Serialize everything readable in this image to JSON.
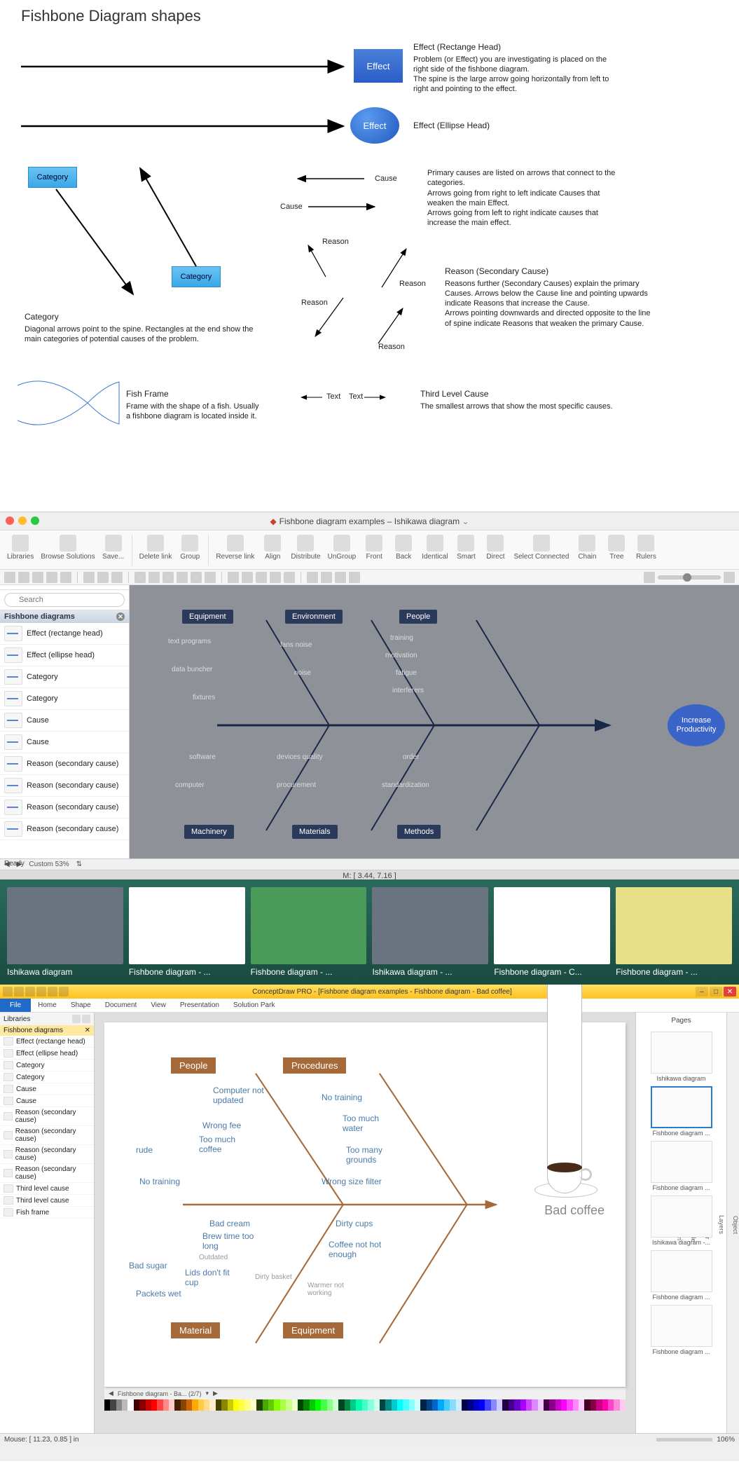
{
  "ref": {
    "title": "Fishbone Diagram shapes",
    "effect_rect": {
      "label": "Effect",
      "heading": "Effect (Rectange Head)",
      "desc": "Problem (or Effect) you are investigating is placed on the right side of the fishbone diagram.\nThe spine is the large arrow going horizontally from left to right and pointing to the effect."
    },
    "effect_ellipse": {
      "label": "Effect",
      "heading": "Effect (Ellipse Head)"
    },
    "category": {
      "label1": "Category",
      "label2": "Category",
      "heading": "Category",
      "desc": "Diagonal arrows point to the spine. Rectangles at the end show the main categories of potential causes of the problem."
    },
    "cause": {
      "label1": "Cause",
      "label2": "Cause",
      "desc": "Primary causes are listed on arrows that connect to the categories.\nArrows going from right to left indicate Causes that weaken the main Effect.\nArrows going from left to right indicate causes that increase the main effect."
    },
    "reason": {
      "label": "Reason",
      "heading": "Reason (Secondary Cause)",
      "desc": "Reasons further (Secondary Causes) explain the primary Causes. Arrows below the Cause line and pointing upwards indicate Reasons that increase the Cause.\nArrows pointing downwards and directed opposite to the line of spine indicate Reasons that weaken the primary Cause."
    },
    "fish": {
      "heading": "Fish Frame",
      "desc": "Frame with the shape of a fish. Usually a fishbone diagram is located inside it."
    },
    "third": {
      "label": "Text",
      "heading": "Third Level Cause",
      "desc": "The smallest arrows that show the most specific causes."
    }
  },
  "mac": {
    "title": "Fishbone diagram examples – Ishikawa diagram",
    "ribbon": [
      "Libraries",
      "Browse Solutions",
      "Save...",
      "",
      "Delete link",
      "Group",
      "",
      "Reverse link",
      "Align",
      "Distribute",
      "UnGroup",
      "Front",
      "Back",
      "Identical",
      "Smart",
      "Direct",
      "Select Connected",
      "Chain",
      "Tree",
      "Rulers"
    ],
    "search_placeholder": "Search",
    "lib_header": "Fishbone diagrams",
    "lib_items": [
      "Effect (rectange head)",
      "Effect (ellipse head)",
      "Category",
      "Category",
      "Cause",
      "Cause",
      "Reason (secondary cause)",
      "Reason (secondary cause)",
      "Reason (secondary cause)",
      "Reason (secondary cause)"
    ],
    "zoom": "Custom 53%",
    "status": "M: [ 3.44, 7.16 ]",
    "ready": "Ready",
    "diagram": {
      "top": [
        "Equipment",
        "Environment",
        "People"
      ],
      "bottom": [
        "Machinery",
        "Materials",
        "Methods"
      ],
      "effect": "Increase Productivity",
      "causes_top": [
        [
          "text programs",
          "data buncher",
          "fixtures"
        ],
        [
          "fans noise",
          "noise"
        ],
        [
          "training",
          "motivation",
          "fatigue",
          "interferers"
        ]
      ],
      "causes_bottom": [
        [
          "software",
          "computer"
        ],
        [
          "devices quality",
          "procurement"
        ],
        [
          "order",
          "standardization"
        ]
      ]
    }
  },
  "thumbs": [
    "Ishikawa diagram",
    "Fishbone diagram - ...",
    "Fishbone diagram - ...",
    "Ishikawa diagram - ...",
    "Fishbone diagram - C...",
    "Fishbone diagram - ..."
  ],
  "win": {
    "title": "ConceptDraw PRO - [Fishbone diagram examples - Fishbone diagram - Bad coffee]",
    "tabs": [
      "File",
      "Home",
      "Shape",
      "Document",
      "View",
      "Presentation",
      "Solution Park"
    ],
    "side_header": "Libraries",
    "lib_header": "Fishbone diagrams",
    "lib_items": [
      "Effect (rectange head)",
      "Effect (ellipse head)",
      "Category",
      "Category",
      "Cause",
      "Cause",
      "Reason (secondary cause)",
      "Reason (secondary cause)",
      "Reason (secondary cause)",
      "Reason (secondary cause)",
      "Third level cause",
      "Third level cause",
      "Fish frame"
    ],
    "pages_header": "Pages",
    "pages": [
      "Ishikawa diagram",
      "Fishbone diagram ...",
      "Fishbone diagram ...",
      "Ishikawa diagram -...",
      "Fishbone diagram ...",
      "Fishbone diagram ..."
    ],
    "rside_tabs": [
      "Object",
      "Layers",
      "Behaviour",
      "Shape Style",
      "Information"
    ],
    "tabstrip": "Fishbone diagram - Ba... (2/7)",
    "status_mouse": "Mouse: [ 11.23, 0.85 ] in",
    "status_zoom": "106%",
    "diagram": {
      "top": [
        "People",
        "Procedures"
      ],
      "bottom": [
        "Material",
        "Equipment"
      ],
      "effect": "Bad coffee",
      "causes": {
        "people": [
          "Computer not updated",
          "Wrong fee",
          "Too much coffee",
          "rude",
          "No training"
        ],
        "procedures": [
          "No training",
          "Too much water",
          "Too many grounds",
          "Wrong size filter"
        ],
        "material": [
          "Bad cream",
          "Brew time too long",
          "Outdated",
          "Lids don't fit cup",
          "Bad sugar",
          "Packets wet",
          "Dirty basket"
        ],
        "equipment": [
          "Dirty cups",
          "Coffee not hot enough",
          "Warmer not working"
        ]
      }
    }
  },
  "palette": [
    "#000",
    "#444",
    "#888",
    "#bbb",
    "#fff",
    "#400",
    "#800",
    "#c00",
    "#f00",
    "#f44",
    "#f88",
    "#fcc",
    "#420",
    "#840",
    "#c60",
    "#fa0",
    "#fc4",
    "#fd8",
    "#fec",
    "#440",
    "#880",
    "#cc0",
    "#ff0",
    "#ff4",
    "#ff8",
    "#ffc",
    "#240",
    "#4a0",
    "#6c0",
    "#8f0",
    "#af4",
    "#cf8",
    "#efc",
    "#040",
    "#080",
    "#0c0",
    "#0f0",
    "#4f4",
    "#8f8",
    "#cfc",
    "#042",
    "#084",
    "#0c8",
    "#0fa",
    "#4fc",
    "#8fd",
    "#cfe",
    "#044",
    "#088",
    "#0cc",
    "#0ff",
    "#4ff",
    "#8ff",
    "#cff",
    "#024",
    "#048",
    "#06c",
    "#0af",
    "#4cf",
    "#8df",
    "#cef",
    "#004",
    "#008",
    "#00c",
    "#00f",
    "#44f",
    "#88f",
    "#ccf",
    "#204",
    "#408",
    "#60c",
    "#a0f",
    "#c4f",
    "#d8f",
    "#ecf",
    "#404",
    "#808",
    "#c0c",
    "#f0f",
    "#f4f",
    "#f8f",
    "#fcf",
    "#402",
    "#804",
    "#c08",
    "#f0a",
    "#f4c",
    "#f8d",
    "#fce"
  ]
}
